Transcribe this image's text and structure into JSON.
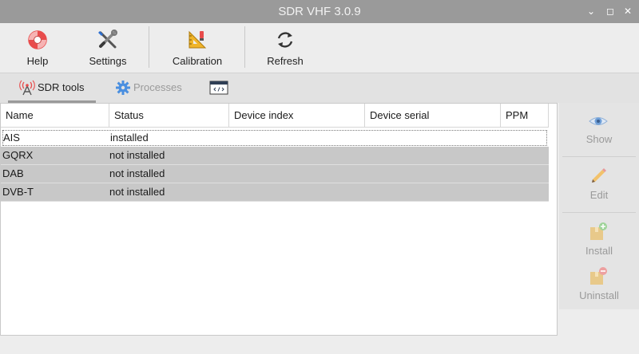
{
  "window": {
    "title": "SDR VHF 3.0.9",
    "min_label": "⌄",
    "max_label": "◻",
    "close_label": "✕"
  },
  "toolbar": {
    "help": {
      "label": "Help",
      "icon": "lifebuoy-icon"
    },
    "settings": {
      "label": "Settings",
      "icon": "wrench-screwdriver-icon"
    },
    "calibration": {
      "label": "Calibration",
      "icon": "set-square-icon"
    },
    "refresh": {
      "label": "Refresh",
      "icon": "refresh-icon"
    }
  },
  "tabs": [
    {
      "label": "SDR tools",
      "icon": "antenna-icon",
      "active": true
    },
    {
      "label": "Processes",
      "icon": "gear-icon",
      "active": false
    },
    {
      "label": "",
      "icon": "code-icon",
      "active": false
    }
  ],
  "table": {
    "columns": [
      "Name",
      "Status",
      "Device index",
      "Device serial",
      "PPM"
    ],
    "rows": [
      {
        "name": "AIS",
        "status": "installed",
        "device_index": "",
        "device_serial": "",
        "ppm": ""
      },
      {
        "name": "GQRX",
        "status": "not installed",
        "device_index": "",
        "device_serial": "",
        "ppm": ""
      },
      {
        "name": "DAB",
        "status": "not installed",
        "device_index": "",
        "device_serial": "",
        "ppm": ""
      },
      {
        "name": "DVB-T",
        "status": "not installed",
        "device_index": "",
        "device_serial": "",
        "ppm": ""
      }
    ]
  },
  "sidebar": {
    "show": {
      "label": "Show",
      "icon": "eye-icon"
    },
    "edit": {
      "label": "Edit",
      "icon": "pencil-icon"
    },
    "install": {
      "label": "Install",
      "icon": "package-add-icon"
    },
    "uninstall": {
      "label": "Uninstall",
      "icon": "package-remove-icon"
    }
  },
  "colors": {
    "titlebar": "#9a9a9a",
    "row_grey": "#c8c8c8",
    "disabled_text": "#9a9a9a",
    "help_red": "#e84c4c",
    "accent_blue": "#3a7bd5"
  }
}
